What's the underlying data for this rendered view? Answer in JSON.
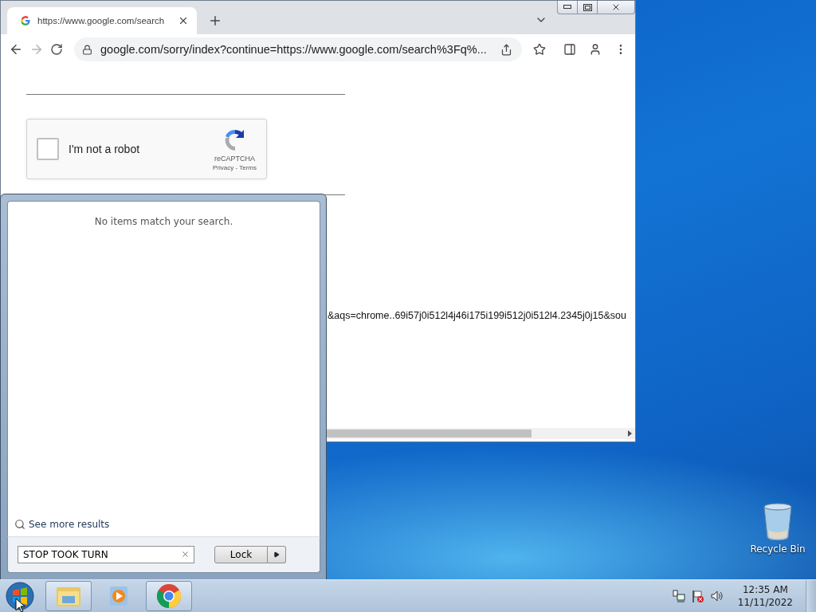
{
  "browser": {
    "tab": {
      "title": "https://www.google.com/search"
    },
    "address": "google.com/sorry/index?continue=https://www.google.com/search%3Fq%...",
    "captcha": {
      "label": "I'm not a robot",
      "checked": false,
      "brand": "reCAPTCHA",
      "links": "Privacy - Terms"
    },
    "url_fragment": "&aqs=chrome..69i57j0i512l4j46i175i199i512j0i512l4.2345j0j15&sou"
  },
  "start_menu": {
    "message": "No items match your search.",
    "see_more": "See more results",
    "search_value": "STOP TOOK TURN",
    "power_button": "Lock"
  },
  "desktop_icons": [
    {
      "label": "Recycle Bin"
    }
  ],
  "taskbar": {
    "time": "12:35 AM",
    "date": "11/11/2022"
  }
}
